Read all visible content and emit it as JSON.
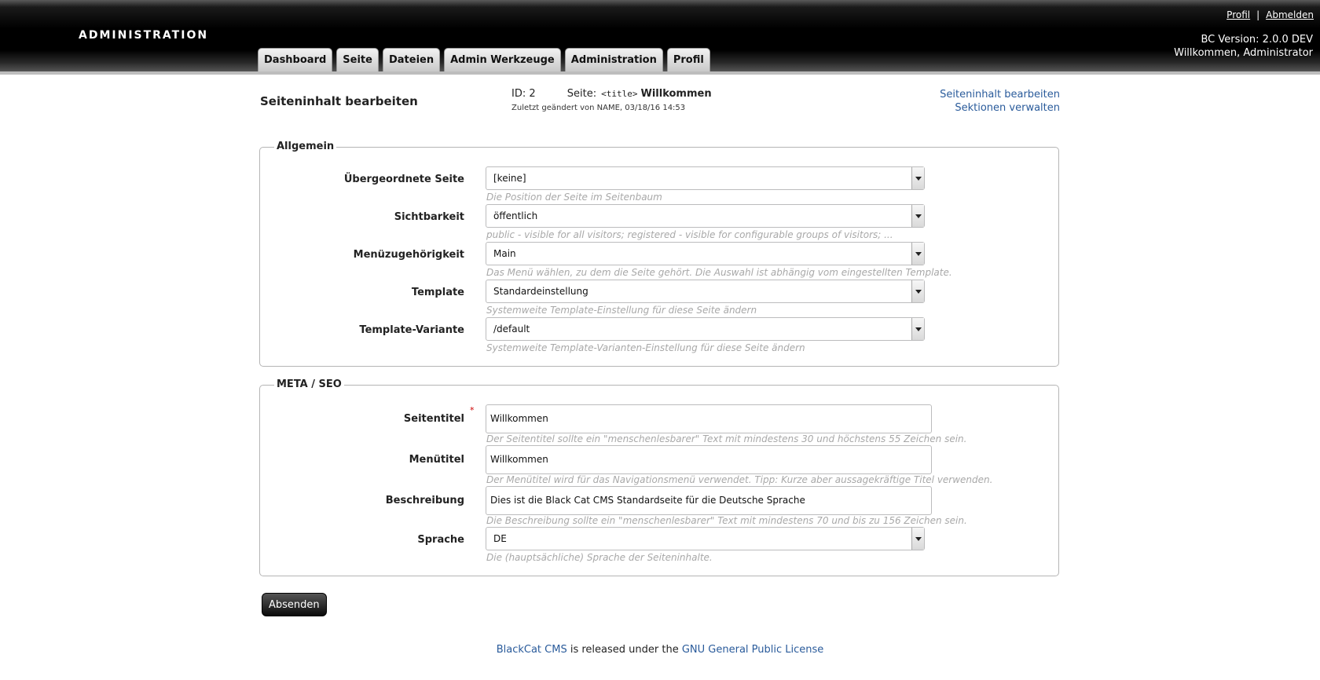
{
  "header": {
    "brand": "ADMINISTRATION",
    "profile_link": "Profil",
    "separator": "|",
    "logout_link": "Abmelden",
    "version": "BC Version: 2.0.0 DEV",
    "welcome": "Willkommen, Administrator"
  },
  "tabs": [
    "Dashboard",
    "Seite",
    "Dateien",
    "Admin Werkzeuge",
    "Administration",
    "Profil"
  ],
  "page": {
    "heading": "Seiteninhalt bearbeiten",
    "id_label": "ID: 2",
    "page_label": "Seite:",
    "title_tag": "<title>",
    "title_value": "Willkommen",
    "changed": "Zuletzt geändert von NAME, 03/18/16 14:53",
    "link_edit": "Seiteninhalt bearbeiten",
    "link_sections": "Sektionen verwalten"
  },
  "general": {
    "legend": "Allgemein",
    "fields": [
      {
        "label": "Übergeordnete Seite",
        "value": "[keine]",
        "hint": "Die Position der Seite im Seitenbaum"
      },
      {
        "label": "Sichtbarkeit",
        "value": "öffentlich",
        "hint": "public - visible for all visitors; registered - visible for configurable groups of visitors; ..."
      },
      {
        "label": "Menüzugehörigkeit",
        "value": "Main",
        "hint": "Das Menü wählen, zu dem die Seite gehört. Die Auswahl ist abhängig vom eingestellten Template."
      },
      {
        "label": "Template",
        "value": "Standardeinstellung",
        "hint": "Systemweite Template-Einstellung für diese Seite ändern"
      },
      {
        "label": "Template-Variante",
        "value": "/default",
        "hint": "Systemweite Template-Varianten-Einstellung für diese Seite ändern"
      }
    ]
  },
  "meta": {
    "legend": "META / SEO",
    "required_mark": "*",
    "fields": [
      {
        "label": "Seitentitel",
        "value": "Willkommen",
        "hint": "Der Seitentitel sollte ein \"menschenlesbarer\" Text mit mindestens 30 und höchstens 55 Zeichen sein."
      },
      {
        "label": "Menütitel",
        "value": "Willkommen",
        "hint": "Der Menütitel wird für das Navigationsmenü verwendet. Tipp: Kurze aber aussagekräftige Titel verwenden."
      },
      {
        "label": "Beschreibung",
        "value": "Dies ist die Black Cat CMS Standardseite für die Deutsche Sprache",
        "hint": "Die Beschreibung sollte ein \"menschenlesbarer\" Text mit mindestens 70 und bis zu 156 Zeichen sein."
      },
      {
        "label": "Sprache",
        "value": "DE",
        "hint": "Die (hauptsächliche) Sprache der Seiteninhalte."
      }
    ]
  },
  "submit_label": "Absenden",
  "footer": {
    "cms_link": "BlackCat CMS",
    "text": " is released under the ",
    "license_link": "GNU General Public License"
  }
}
